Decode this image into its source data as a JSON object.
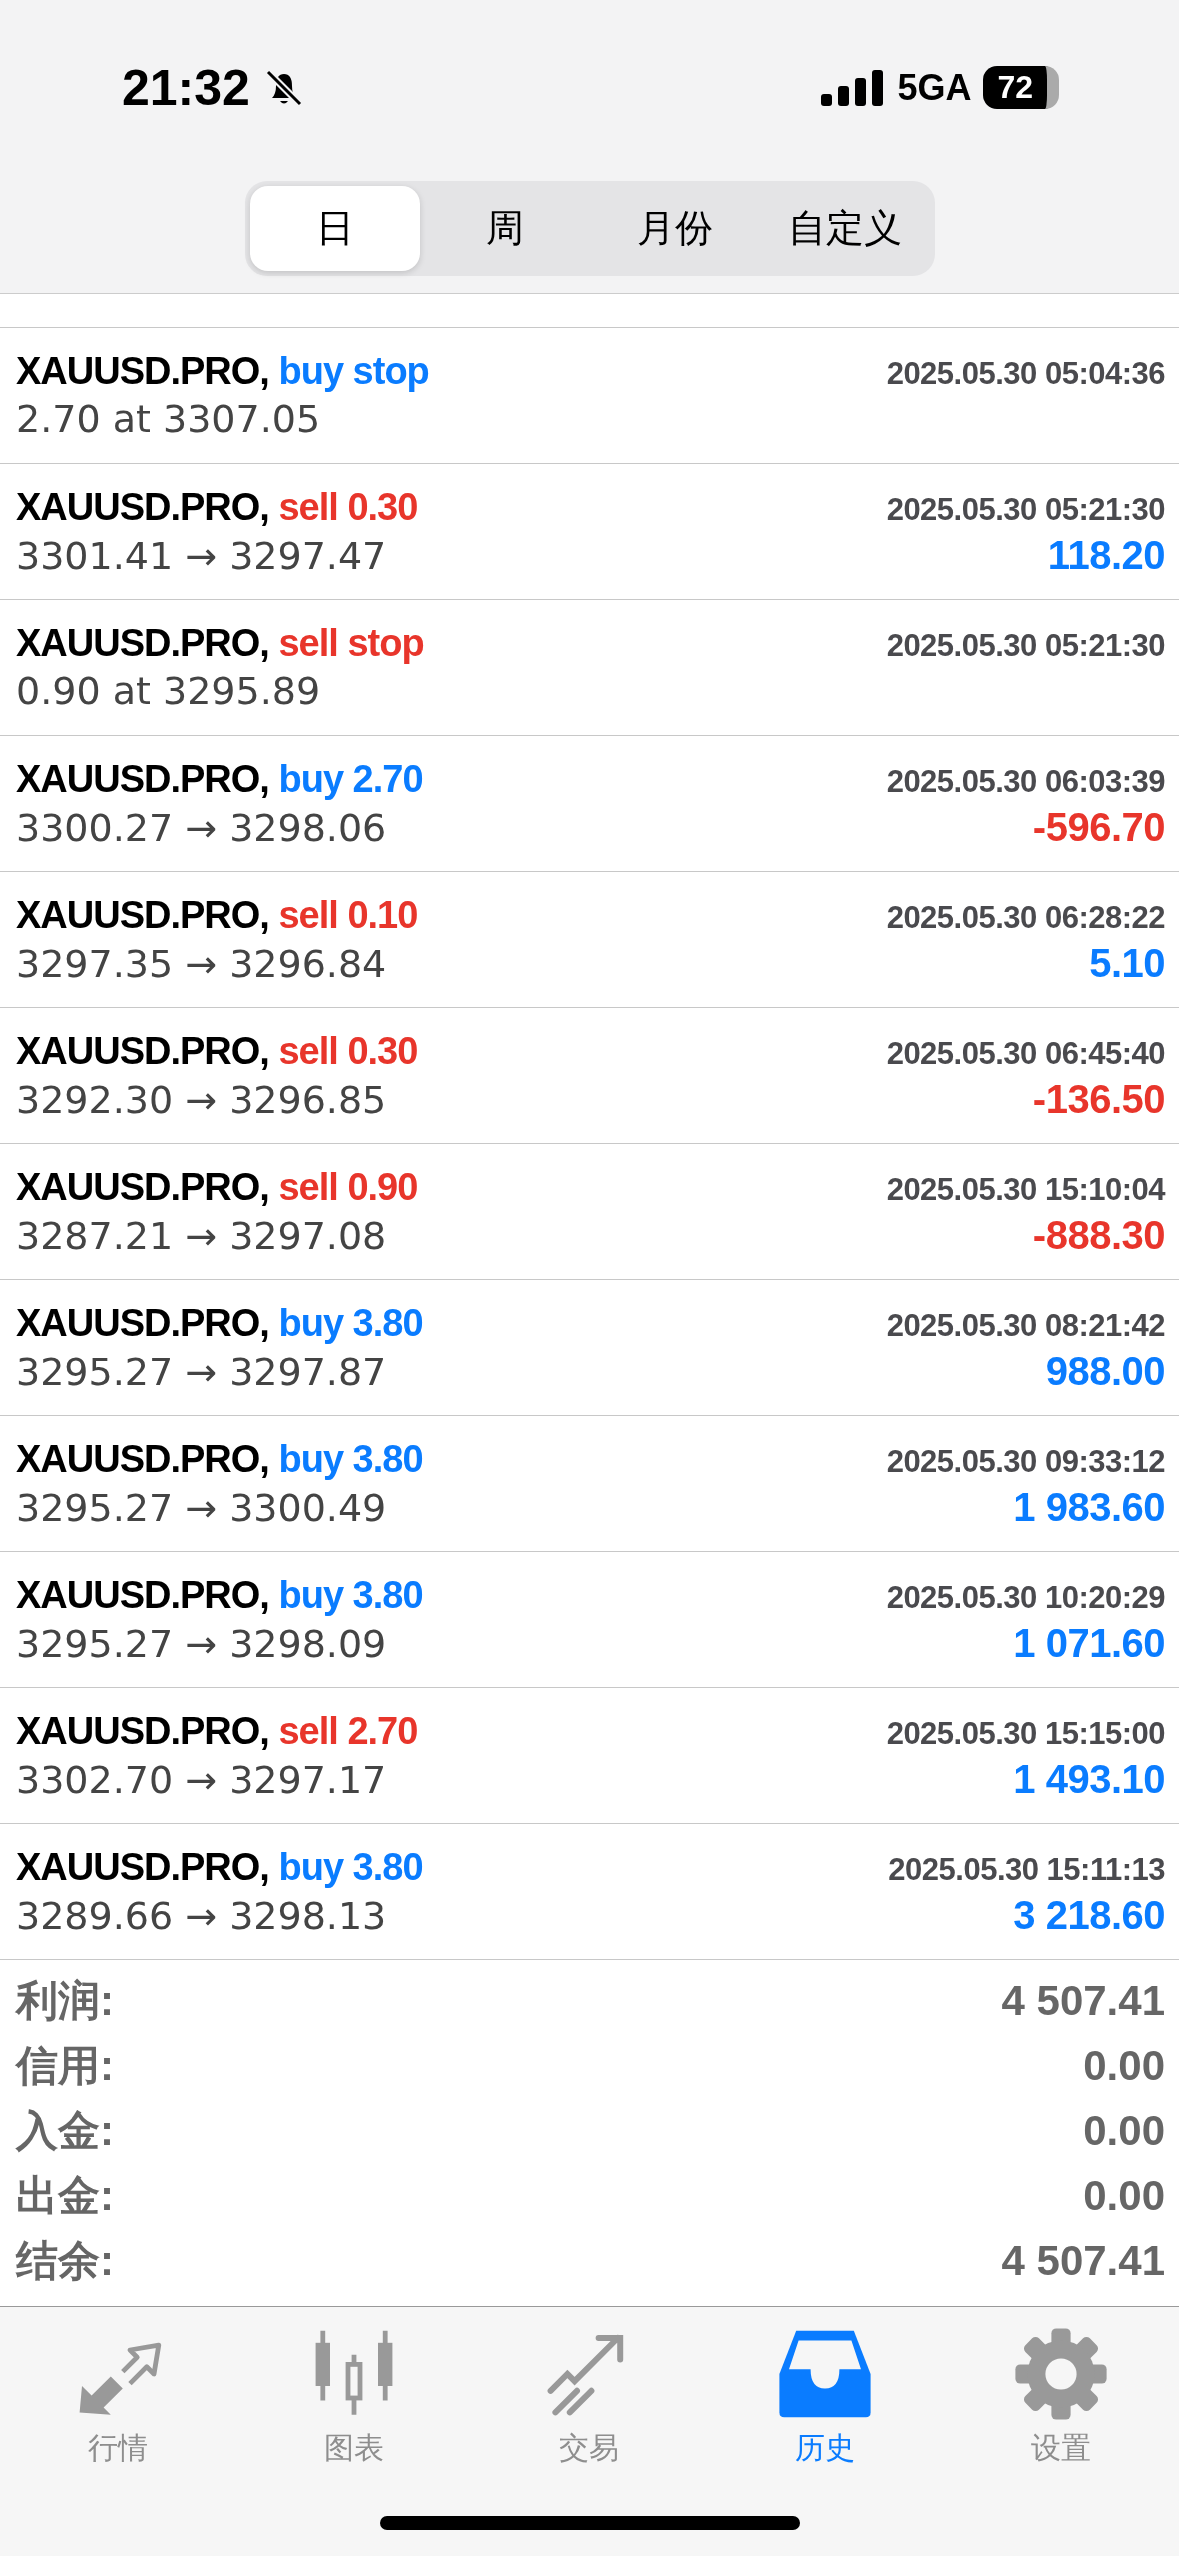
{
  "status_bar": {
    "time": "21:32",
    "network": "5GA",
    "battery": "72"
  },
  "period_tabs": [
    {
      "label": "日",
      "selected": true
    },
    {
      "label": "周",
      "selected": false
    },
    {
      "label": "月份",
      "selected": false
    },
    {
      "label": "自定义",
      "selected": false
    }
  ],
  "history": [
    {
      "symbol": "XAUUSD.PRO,",
      "kind": "buy",
      "action": "buy stop",
      "time": "2025.05.30 05:04:36",
      "detail": "2.70 at 3307.05"
    },
    {
      "symbol": "XAUUSD.PRO,",
      "kind": "sell",
      "action": "sell 0.30",
      "time": "2025.05.30 05:21:30",
      "detail": "3301.41 → 3297.47",
      "profit": "118.20",
      "color": "#0a7cff"
    },
    {
      "symbol": "XAUUSD.PRO,",
      "kind": "sell",
      "action": "sell stop",
      "time": "2025.05.30 05:21:30",
      "detail": "0.90 at 3295.89"
    },
    {
      "symbol": "XAUUSD.PRO,",
      "kind": "buy",
      "action": "buy 2.70",
      "time": "2025.05.30 06:03:39",
      "detail": "3300.27 → 3298.06",
      "profit": "-596.70",
      "color": "#e8352b"
    },
    {
      "symbol": "XAUUSD.PRO,",
      "kind": "sell",
      "action": "sell 0.10",
      "time": "2025.05.30 06:28:22",
      "detail": "3297.35 → 3296.84",
      "profit": "5.10",
      "color": "#0a7cff"
    },
    {
      "symbol": "XAUUSD.PRO,",
      "kind": "sell",
      "action": "sell 0.30",
      "time": "2025.05.30 06:45:40",
      "detail": "3292.30 → 3296.85",
      "profit": "-136.50",
      "color": "#e8352b"
    },
    {
      "symbol": "XAUUSD.PRO,",
      "kind": "sell",
      "action": "sell 0.90",
      "time": "2025.05.30 15:10:04",
      "detail": "3287.21 → 3297.08",
      "profit": "-888.30",
      "color": "#e8352b"
    },
    {
      "symbol": "XAUUSD.PRO,",
      "kind": "buy",
      "action": "buy 3.80",
      "time": "2025.05.30 08:21:42",
      "detail": "3295.27 → 3297.87",
      "profit": "988.00",
      "color": "#0a7cff"
    },
    {
      "symbol": "XAUUSD.PRO,",
      "kind": "buy",
      "action": "buy 3.80",
      "time": "2025.05.30 09:33:12",
      "detail": "3295.27 → 3300.49",
      "profit": "1 983.60",
      "color": "#0a7cff"
    },
    {
      "symbol": "XAUUSD.PRO,",
      "kind": "buy",
      "action": "buy 3.80",
      "time": "2025.05.30 10:20:29",
      "detail": "3295.27 → 3298.09",
      "profit": "1 071.60",
      "color": "#0a7cff"
    },
    {
      "symbol": "XAUUSD.PRO,",
      "kind": "sell",
      "action": "sell 2.70",
      "time": "2025.05.30 15:15:00",
      "detail": "3302.70 → 3297.17",
      "profit": "1 493.10",
      "color": "#0a7cff"
    },
    {
      "symbol": "XAUUSD.PRO,",
      "kind": "buy",
      "action": "buy 3.80",
      "time": "2025.05.30 15:11:13",
      "detail": "3289.66 → 3298.13",
      "profit": "3 218.60",
      "color": "#0a7cff"
    }
  ],
  "summary": [
    {
      "label": "利润:",
      "value": "4 507.41"
    },
    {
      "label": "信用:",
      "value": "0.00"
    },
    {
      "label": "入金:",
      "value": "0.00"
    },
    {
      "label": "出金:",
      "value": "0.00"
    },
    {
      "label": "结余:",
      "value": "4 507.41"
    }
  ],
  "tab_bar": [
    {
      "label": "行情",
      "kind": "quotes",
      "selected": false
    },
    {
      "label": "图表",
      "kind": "chart",
      "selected": false
    },
    {
      "label": "交易",
      "kind": "trade",
      "selected": false
    },
    {
      "label": "历史",
      "kind": "history",
      "selected": true
    },
    {
      "label": "设置",
      "kind": "settings",
      "selected": false
    }
  ]
}
